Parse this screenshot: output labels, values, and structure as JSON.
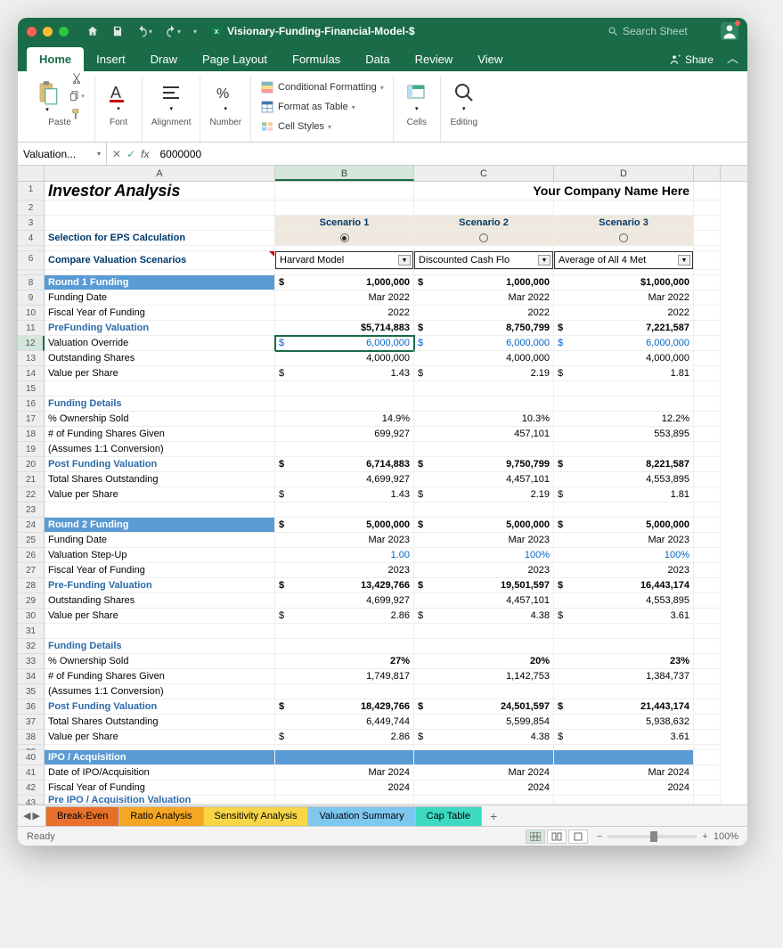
{
  "titlebar": {
    "doc_name": "Visionary-Funding-Financial-Model-$",
    "search_placeholder": "Search Sheet"
  },
  "ribbon_tabs": [
    "Home",
    "Insert",
    "Draw",
    "Page Layout",
    "Formulas",
    "Data",
    "Review",
    "View"
  ],
  "share_label": "Share",
  "ribbon": {
    "paste": "Paste",
    "font": "Font",
    "alignment": "Alignment",
    "number": "Number",
    "cond_fmt": "Conditional Formatting",
    "fmt_table": "Format as Table",
    "cell_styles": "Cell Styles",
    "cells": "Cells",
    "editing": "Editing"
  },
  "namebox": "Valuation...",
  "formula": "6000000",
  "columns": [
    "A",
    "B",
    "C",
    "D"
  ],
  "sheet": {
    "title": "Investor Analysis",
    "company": "Your Company Name Here",
    "scenarios": [
      "Scenario 1",
      "Scenario 2",
      "Scenario 3"
    ],
    "sel_eps": "Selection for EPS Calculation",
    "compare": "Compare Valuation Scenarios",
    "dropdowns": [
      "Harvard Model",
      "Discounted Cash Flo",
      "Average of All 4 Met"
    ],
    "rows": {
      "8": {
        "label": "Round 1 Funding",
        "b": {
          "s": "$",
          "v": "1,000,000"
        },
        "c": {
          "s": "$",
          "v": "1,000,000"
        },
        "d": {
          "s": "",
          "v": "$1,000,000"
        },
        "style": "fill-blue",
        "bold": true
      },
      "9": {
        "label": "Funding Date",
        "b": "Mar 2022",
        "c": "Mar 2022",
        "d": "Mar 2022"
      },
      "10": {
        "label": "Fiscal Year of Funding",
        "b": "2022",
        "c": "2022",
        "d": "2022"
      },
      "11": {
        "label": "PreFunding Valuation",
        "b": {
          "s": "",
          "v": "$5,714,883"
        },
        "c": {
          "s": "$",
          "v": "8,750,799"
        },
        "d": {
          "s": "$",
          "v": "7,221,587"
        },
        "style": "sec",
        "bold": true
      },
      "12": {
        "label": "Valuation Override",
        "b": {
          "s": "$",
          "v": "6,000,000"
        },
        "c": {
          "s": "$",
          "v": "6,000,000"
        },
        "d": {
          "s": "$",
          "v": "6,000,000"
        },
        "blue": true
      },
      "13": {
        "label": "Outstanding Shares",
        "b": "4,000,000",
        "c": "4,000,000",
        "d": "4,000,000"
      },
      "14": {
        "label": "Value per Share",
        "b": {
          "s": "$",
          "v": "1.43"
        },
        "c": {
          "s": "$",
          "v": "2.19"
        },
        "d": {
          "s": "$",
          "v": "1.81"
        }
      },
      "16": {
        "label": "Funding Details",
        "style": "sec"
      },
      "17": {
        "label": "% Ownership Sold",
        "b": "14.9%",
        "c": "10.3%",
        "d": "12.2%"
      },
      "18": {
        "label": "# of Funding Shares Given",
        "b": "699,927",
        "c": "457,101",
        "d": "553,895"
      },
      "19": {
        "label": "(Assumes 1:1 Conversion)"
      },
      "20": {
        "label": "Post Funding Valuation",
        "b": {
          "s": "$",
          "v": "6,714,883"
        },
        "c": {
          "s": "$",
          "v": "9,750,799"
        },
        "d": {
          "s": "$",
          "v": "8,221,587"
        },
        "style": "sec",
        "bold": true
      },
      "21": {
        "label": "Total Shares Outstanding",
        "b": "4,699,927",
        "c": "4,457,101",
        "d": "4,553,895"
      },
      "22": {
        "label": "Value per Share",
        "b": {
          "s": "$",
          "v": "1.43"
        },
        "c": {
          "s": "$",
          "v": "2.19"
        },
        "d": {
          "s": "$",
          "v": "1.81"
        }
      },
      "24": {
        "label": "Round 2 Funding",
        "b": {
          "s": "$",
          "v": "5,000,000"
        },
        "c": {
          "s": "$",
          "v": "5,000,000"
        },
        "d": {
          "s": "$",
          "v": "5,000,000"
        },
        "style": "fill-blue",
        "bold": true
      },
      "25": {
        "label": "Funding Date",
        "b": "Mar 2023",
        "c": "Mar 2023",
        "d": "Mar 2023"
      },
      "26": {
        "label": "Valuation Step-Up",
        "b": "1.00",
        "c": "100%",
        "d": "100%",
        "blue": true
      },
      "27": {
        "label": "Fiscal Year of Funding",
        "b": "2023",
        "c": "2023",
        "d": "2023"
      },
      "28": {
        "label": "Pre-Funding Valuation",
        "b": {
          "s": "$",
          "v": "13,429,766"
        },
        "c": {
          "s": "$",
          "v": "19,501,597"
        },
        "d": {
          "s": "$",
          "v": "16,443,174"
        },
        "style": "sec",
        "bold": true
      },
      "29": {
        "label": "Outstanding Shares",
        "b": "4,699,927",
        "c": "4,457,101",
        "d": "4,553,895"
      },
      "30": {
        "label": "Value per Share",
        "b": {
          "s": "$",
          "v": "2.86"
        },
        "c": {
          "s": "$",
          "v": "4.38"
        },
        "d": {
          "s": "$",
          "v": "3.61"
        }
      },
      "32": {
        "label": "Funding Details",
        "style": "sec"
      },
      "33": {
        "label": "% Ownership Sold",
        "b": "27%",
        "c": "20%",
        "d": "23%",
        "bold": true
      },
      "34": {
        "label": "# of Funding Shares Given",
        "b": "1,749,817",
        "c": "1,142,753",
        "d": "1,384,737"
      },
      "35": {
        "label": "(Assumes 1:1 Conversion)"
      },
      "36": {
        "label": "Post Funding Valuation",
        "b": {
          "s": "$",
          "v": "18,429,766"
        },
        "c": {
          "s": "$",
          "v": "24,501,597"
        },
        "d": {
          "s": "$",
          "v": "21,443,174"
        },
        "style": "sec",
        "bold": true
      },
      "37": {
        "label": "Total Shares Outstanding",
        "b": "6,449,744",
        "c": "5,599,854",
        "d": "5,938,632"
      },
      "38": {
        "label": "Value per Share",
        "b": {
          "s": "$",
          "v": "2.86"
        },
        "c": {
          "s": "$",
          "v": "4.38"
        },
        "d": {
          "s": "$",
          "v": "3.61"
        }
      },
      "40": {
        "label": "IPO / Acquisition",
        "style": "fill-blue"
      },
      "41": {
        "label": "Date of IPO/Acquisition",
        "b": "Mar 2024",
        "c": "Mar 2024",
        "d": "Mar 2024"
      },
      "42": {
        "label": "Fiscal Year of Funding",
        "b": "2024",
        "c": "2024",
        "d": "2024"
      },
      "43": {
        "label": "Pre IPO / Acquisition Valuation",
        "style": "sec"
      }
    }
  },
  "sheet_tabs": [
    {
      "name": "Break-Even",
      "color": "#e8702a"
    },
    {
      "name": "Ratio Analysis",
      "color": "#f5a623"
    },
    {
      "name": "Sensitivity Analysis",
      "color": "#f8d648"
    },
    {
      "name": "Valuation Summary",
      "color": "#7ec8f0"
    },
    {
      "name": "Cap Table",
      "color": "#3dd9c1"
    }
  ],
  "status": {
    "ready": "Ready",
    "zoom": "100%"
  }
}
